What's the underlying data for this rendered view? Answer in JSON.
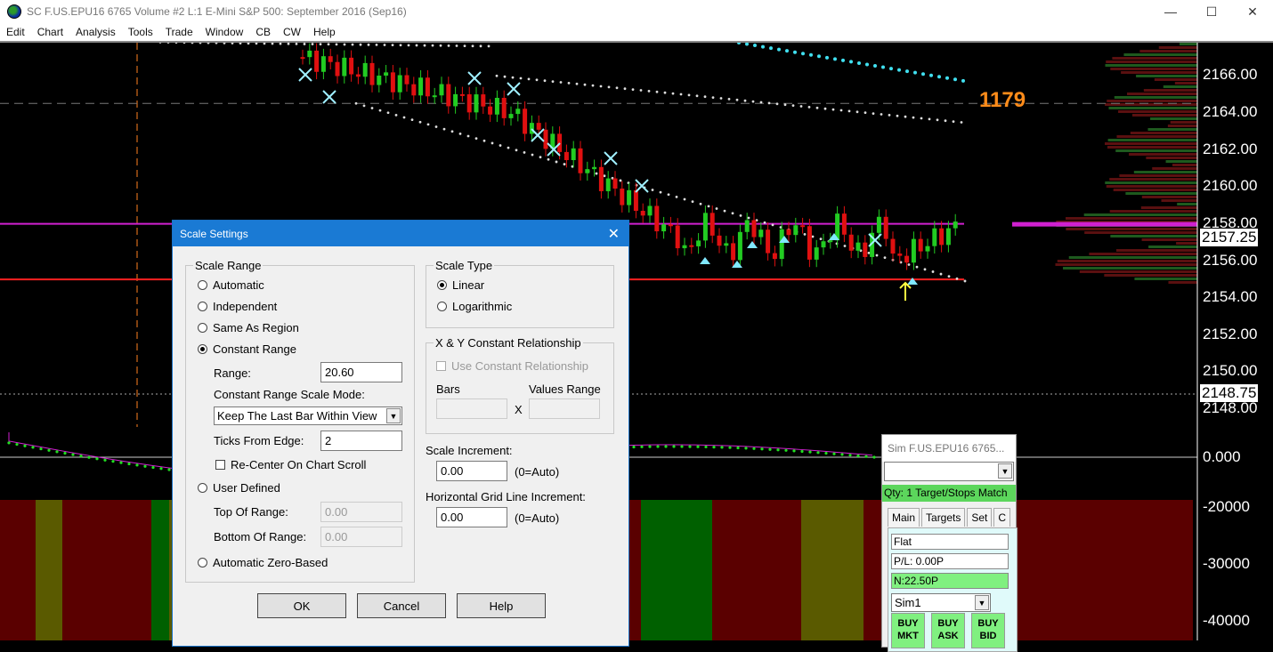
{
  "window": {
    "title": "SC F.US.EPU16  6765 Volume  #2  L:1  E-Mini S&P 500: September 2016 (Sep16)",
    "minimize": "—",
    "maximize": "☐",
    "close": "✕"
  },
  "menu": [
    "Edit",
    "Chart",
    "Analysis",
    "Tools",
    "Trade",
    "Window",
    "CB",
    "CW",
    "Help"
  ],
  "chart": {
    "price_labels": [
      "2166.00",
      "2164.00",
      "2162.00",
      "2160.00",
      "2158.00",
      "2156.00",
      "2154.00",
      "2152.00",
      "2150.00",
      "2148.00"
    ],
    "current_price": "2157.25",
    "cursor_price": "2148.75",
    "indicator_labels": [
      "0.000",
      "-20000",
      "-30000",
      "-40000"
    ],
    "volume_marker": "1179",
    "colors": {
      "up": "#22cc22",
      "down": "#e01010",
      "magenta": "#d020d0",
      "red_line": "#ff2020",
      "cyan": "#40e0f0"
    }
  },
  "dialog": {
    "title": "Scale Settings",
    "scale_range": {
      "legend": "Scale Range",
      "options": [
        "Automatic",
        "Independent",
        "Same As Region",
        "Constant Range",
        "User Defined",
        "Automatic Zero-Based"
      ],
      "selected": "Constant Range",
      "range_label": "Range:",
      "range_value": "20.60",
      "mode_label": "Constant Range Scale Mode:",
      "mode_value": "Keep The Last Bar Within View",
      "ticks_label": "Ticks From Edge:",
      "ticks_value": "2",
      "recenter_label": "Re-Center On Chart Scroll",
      "top_label": "Top Of Range:",
      "top_value": "0.00",
      "bottom_label": "Bottom Of Range:",
      "bottom_value": "0.00"
    },
    "scale_type": {
      "legend": "Scale Type",
      "options": [
        "Linear",
        "Logarithmic"
      ],
      "selected": "Linear"
    },
    "xy": {
      "legend": "X & Y Constant Relationship",
      "use_label": "Use Constant Relationship",
      "bars_label": "Bars",
      "values_label": "Values Range",
      "x": "X"
    },
    "scale_increment": {
      "label": "Scale Increment:",
      "value": "0.00",
      "hint": "(0=Auto)"
    },
    "grid_increment": {
      "label": "Horizontal Grid Line Increment:",
      "value": "0.00",
      "hint": "(0=Auto)"
    },
    "buttons": {
      "ok": "OK",
      "cancel": "Cancel",
      "help": "Help"
    }
  },
  "trade": {
    "title": "Sim F.US.EPU16  6765...",
    "qty": "Qty: 1 Target/Stops Match",
    "tabs": [
      "Main",
      "Targets",
      "Set",
      "C"
    ],
    "position": "Flat",
    "pl": "P/L: 0.00P",
    "n": "N:22.50P",
    "account": "Sim1",
    "buy": [
      [
        "BUY",
        "MKT"
      ],
      [
        "BUY",
        "ASK"
      ],
      [
        "BUY",
        "BID"
      ]
    ]
  }
}
